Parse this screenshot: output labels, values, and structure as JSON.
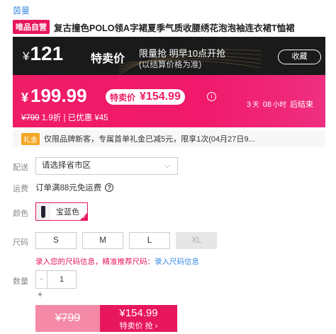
{
  "brand": "茵曼",
  "product": {
    "vip_badge": "唯品自营",
    "title": "复古撞色POLO领A字裙夏季气质收腰绣花泡泡袖连衣裙T恤裙"
  },
  "flash_sale": {
    "currency": "¥",
    "price": "121",
    "label": "特卖价",
    "line1": "限量抢 明早10点开抢",
    "line2": "(以结算价格为准)",
    "collect_label": "收藏"
  },
  "price_panel": {
    "currency": "¥",
    "price": "199.99",
    "special_label": "特卖价",
    "special_price": "¥154.99",
    "info_icon": "i",
    "original": "¥799",
    "discount": "1.9折",
    "saved": "| 已优惠 ¥45",
    "countdown": {
      "days": "3",
      "days_unit": "天",
      "hours": "08",
      "hours_unit": "小时",
      "suffix": "后结束"
    }
  },
  "promo": {
    "tag": "礼金",
    "text": "仅限品牌新客，专属首单礼金已减5元，限享1次(04月27日9..."
  },
  "delivery": {
    "label": "配送",
    "placeholder": "请选择省市区",
    "chevron": "⌵"
  },
  "shipping": {
    "label": "运费",
    "text": "订单满88元免运费",
    "help_icon": "?"
  },
  "color": {
    "label": "颜色",
    "option": "宝蓝色",
    "check": "✓"
  },
  "size": {
    "label": "尺码",
    "options": [
      "S",
      "M",
      "L",
      "XL"
    ],
    "link_pink": "录入您的尺码信息，精准推荐尺码：",
    "link_blue": "录入尺码信息"
  },
  "quantity": {
    "label": "数量",
    "minus": "−",
    "value": "1",
    "plus": "+"
  },
  "actions": {
    "original_price": "¥799",
    "buy_price": "¥154.99",
    "buy_label": "特卖价 抢 ›"
  },
  "colors": {
    "accent": "#e8175d",
    "link": "#3a8ee6",
    "dark_bar": "#1a1a1a"
  }
}
